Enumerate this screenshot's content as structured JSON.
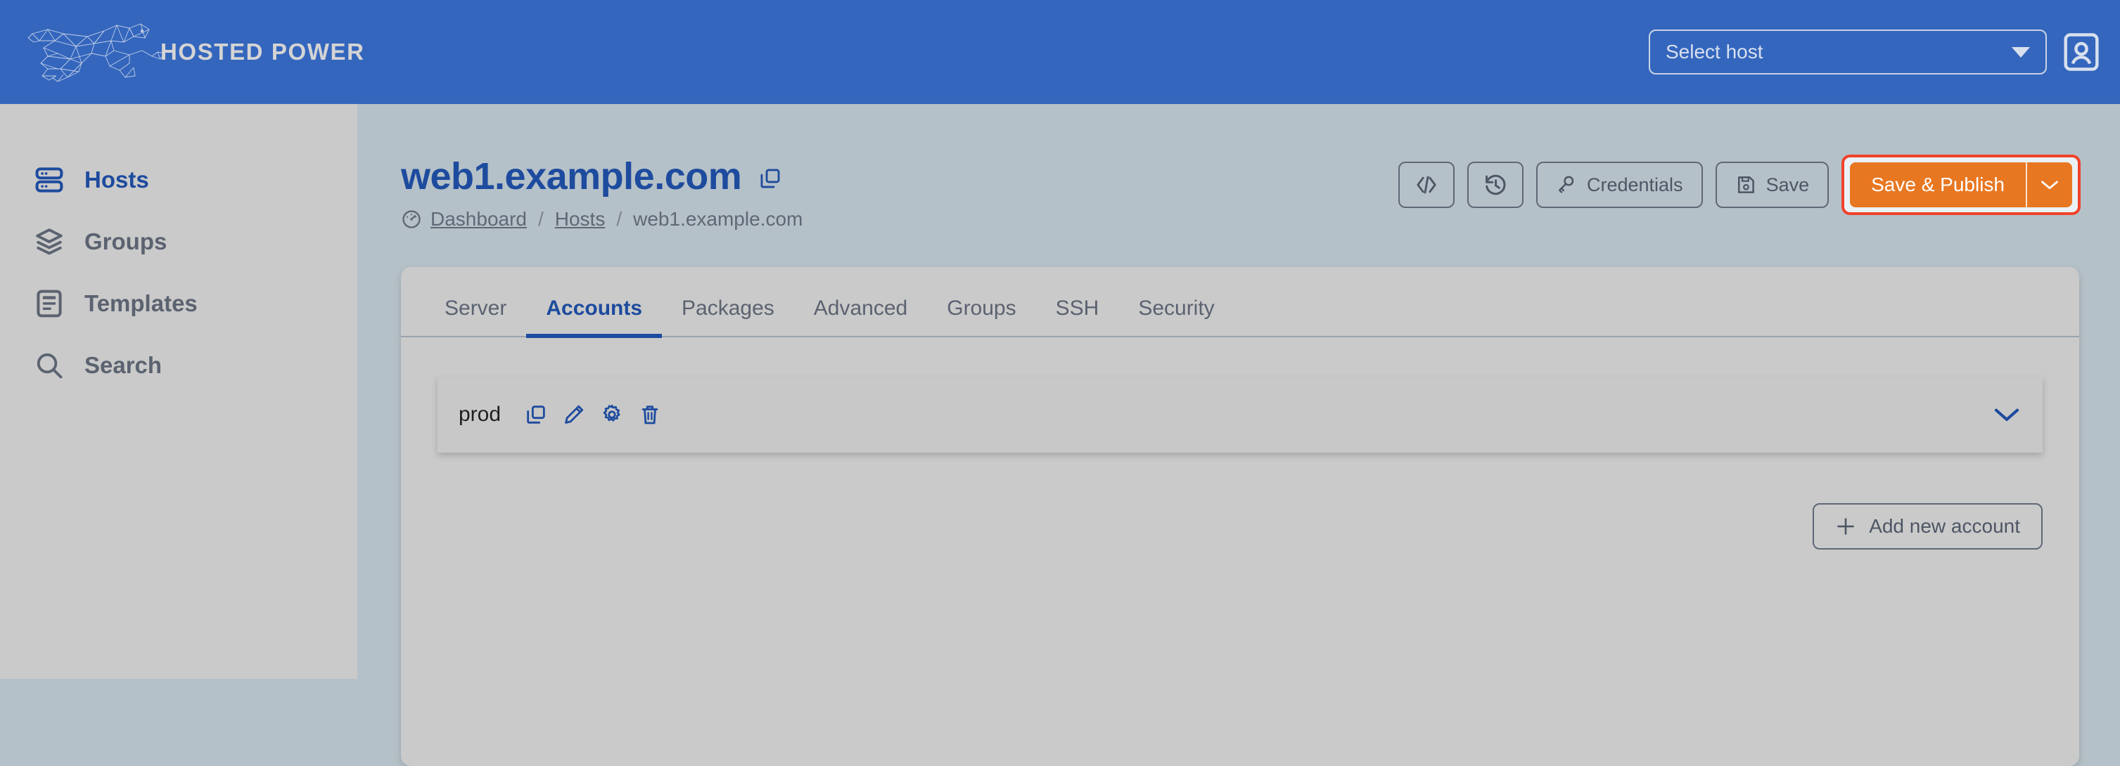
{
  "header": {
    "logo_text": "HOSTED POWER",
    "host_select": {
      "value": "Select host",
      "placeholder": "Select host"
    },
    "account_icon": "account-card-icon"
  },
  "sidebar": {
    "items": [
      {
        "label": "Hosts",
        "icon": "server-icon",
        "active": true
      },
      {
        "label": "Groups",
        "icon": "layers-icon",
        "active": false
      },
      {
        "label": "Templates",
        "icon": "document-icon",
        "active": false
      },
      {
        "label": "Search",
        "icon": "search-icon",
        "active": false
      }
    ]
  },
  "page": {
    "title": "web1.example.com",
    "copy_icon": "copy-icon",
    "breadcrumb": {
      "icon": "dashboard-gauge-icon",
      "items": [
        "Dashboard",
        "Hosts",
        "web1.example.com"
      ],
      "separator": "/"
    }
  },
  "toolbar": {
    "code_button": {
      "label": "",
      "icon": "code-brackets-icon"
    },
    "history_button": {
      "label": "",
      "icon": "history-clock-icon"
    },
    "credentials_button": {
      "label": "Credentials",
      "icon": "key-icon"
    },
    "save_button": {
      "label": "Save",
      "icon": "floppy-disk-icon"
    },
    "publish_button": {
      "label": "Save & Publish",
      "caret_icon": "chevron-down-icon"
    }
  },
  "tabs": [
    {
      "label": "Server",
      "active": false
    },
    {
      "label": "Accounts",
      "active": true
    },
    {
      "label": "Packages",
      "active": false
    },
    {
      "label": "Advanced",
      "active": false
    },
    {
      "label": "Groups",
      "active": false
    },
    {
      "label": "SSH",
      "active": false
    },
    {
      "label": "Security",
      "active": false
    }
  ],
  "accounts": {
    "rows": [
      {
        "name": "prod",
        "actions": [
          "copy-icon",
          "edit-pencil-icon",
          "settings-gear-icon",
          "delete-trash-icon"
        ],
        "expand_icon": "chevron-down-icon"
      }
    ],
    "add_button": {
      "label": "Add new account",
      "icon": "plus-icon"
    }
  },
  "colors": {
    "header_blue": "#3466bd",
    "accent_blue": "#1d4b9e",
    "orange": "#e87722",
    "highlight_red": "#f0422a",
    "sidebar_gray": "#cacaca",
    "page_bg": "#b5c1c8"
  }
}
